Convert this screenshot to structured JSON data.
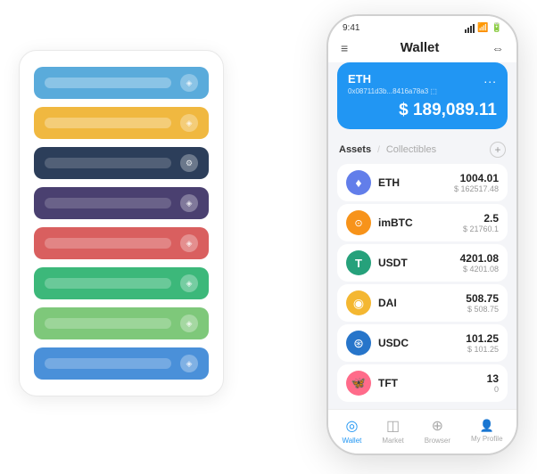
{
  "left_panel": {
    "cards": [
      {
        "color": "c1",
        "icon": "◈"
      },
      {
        "color": "c2",
        "icon": "◈"
      },
      {
        "color": "c3",
        "icon": "⚙"
      },
      {
        "color": "c4",
        "icon": "◈"
      },
      {
        "color": "c5",
        "icon": "◈"
      },
      {
        "color": "c6",
        "icon": "◈"
      },
      {
        "color": "c7",
        "icon": "◈"
      },
      {
        "color": "c8",
        "icon": "◈"
      }
    ]
  },
  "phone": {
    "status": {
      "time": "9:41",
      "signal": "▲▲▲",
      "wifi": "wifi",
      "battery": "battery"
    },
    "header": {
      "menu_icon": "≡",
      "title": "Wallet",
      "scan_icon": "⇔"
    },
    "eth_card": {
      "name": "ETH",
      "address": "0x08711d3b...8416a78a3 ⬚",
      "dots": "...",
      "balance": "$ 189,089.11"
    },
    "assets": {
      "tab_active": "Assets",
      "divider": "/",
      "tab_inactive": "Collectibles",
      "add_icon": "+"
    },
    "asset_list": [
      {
        "name": "ETH",
        "icon": "♦",
        "icon_bg": "#627eea",
        "icon_color": "#fff",
        "amount": "1004.01",
        "usd": "$ 162517.48"
      },
      {
        "name": "imBTC",
        "icon": "⊙",
        "icon_bg": "#f7931a",
        "icon_color": "#fff",
        "amount": "2.5",
        "usd": "$ 21760.1"
      },
      {
        "name": "USDT",
        "icon": "T",
        "icon_bg": "#26a17b",
        "icon_color": "#fff",
        "amount": "4201.08",
        "usd": "$ 4201.08"
      },
      {
        "name": "DAI",
        "icon": "◉",
        "icon_bg": "#f4b731",
        "icon_color": "#fff",
        "amount": "508.75",
        "usd": "$ 508.75"
      },
      {
        "name": "USDC",
        "icon": "⊛",
        "icon_bg": "#2775ca",
        "icon_color": "#fff",
        "amount": "101.25",
        "usd": "$ 101.25"
      },
      {
        "name": "TFT",
        "icon": "🦋",
        "icon_bg": "#ff6b8a",
        "icon_color": "#fff",
        "amount": "13",
        "usd": "0"
      }
    ],
    "nav": [
      {
        "icon": "◎",
        "label": "Wallet",
        "active": true
      },
      {
        "icon": "◫",
        "label": "Market",
        "active": false
      },
      {
        "icon": "⊕",
        "label": "Browser",
        "active": false
      },
      {
        "icon": "👤",
        "label": "My Profile",
        "active": false
      }
    ]
  }
}
